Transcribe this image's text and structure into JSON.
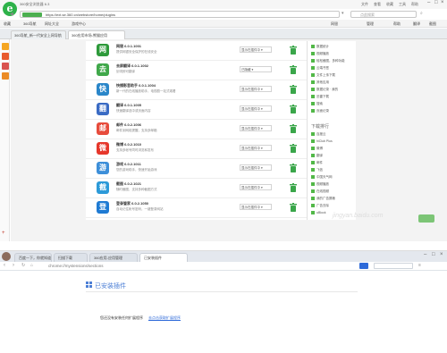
{
  "top_browser": {
    "title": "360安全浏览器 6.3",
    "menu": [
      "文件",
      "查看",
      "收藏",
      "工具",
      "帮助"
    ],
    "address": "https://ext.se.360.cn/webstore/home/plugins",
    "search_placeholder": "点此搜索",
    "bookmarks": [
      "收藏",
      "360导航",
      "网址大全",
      "游戏中心",
      "网银",
      "管理",
      "帮助",
      "翻译",
      "截图"
    ],
    "tabs": [
      "360导航_新一代安全上网导航",
      "360应用市场-熊猫应用"
    ],
    "extensions": [
      {
        "name": "网银",
        "version": "6.0.1.1001",
        "desc": "提供网银安全保护的在线安全",
        "status": "显示在插件中",
        "icon": "bank-icon",
        "color": "#2d9a3a"
      },
      {
        "name": "去屏翻译",
        "version": "6.0.1.1002",
        "desc": "划词即可翻译",
        "status": "已隐藏",
        "icon": "translate-icon",
        "color": "#40a84a"
      },
      {
        "name": "快播影音助手",
        "version": "6.0.1.1004",
        "desc": "新一代的在线播放助手，电视剧一站式观看",
        "status": "显示在插件中",
        "icon": "play-icon",
        "color": "#2a86c9"
      },
      {
        "name": "翻译",
        "version": "6.0.1.1005",
        "desc": "快速翻译选中或页面内容",
        "status": "显示在插件中",
        "icon": "translate-icon",
        "color": "#3a6bc4"
      },
      {
        "name": "邮件",
        "version": "6.0.2.1006",
        "desc": "邮件到网络提醒，支持多邮箱",
        "status": "显示在插件中",
        "icon": "mail-icon",
        "color": "#e74c3c"
      },
      {
        "name": "微博",
        "version": "6.0.2.1010",
        "desc": "支持多帐号同时浏览和发布",
        "status": "显示在插件中",
        "icon": "weibo-icon",
        "color": "#e6372b"
      },
      {
        "name": "游戏",
        "version": "6.0.2.1011",
        "desc": "您的游戏助手，快速开始游戏",
        "status": "显示在插件中",
        "icon": "game-icon",
        "color": "#3d8fd9"
      },
      {
        "name": "截图",
        "version": "6.0.2.1021",
        "desc": "随时截图，支持多种截图方式",
        "status": "显示在插件中",
        "icon": "screenshot-icon",
        "color": "#2c9ad8"
      },
      {
        "name": "登录管家",
        "version": "6.0.2.1050",
        "desc": "自动记住帐号密码，一键登录网站",
        "status": "显示在插件中",
        "icon": "wrench-icon",
        "color": "#1f7bd3"
      }
    ],
    "side_items_top": [
      "数据统计",
      "视频播放",
      "轻松截图，多种功能",
      "云端书签",
      "文件上传下载",
      "其他应用",
      "数据记录 · 我的",
      "迅雷下载",
      "搜索",
      "页面记录"
    ],
    "side_title": "下载排行",
    "side_items_bottom": [
      "百度云",
      "hiClub Plus",
      "微博",
      "翻译",
      "邮件",
      "飞信",
      "中国天气网",
      "视频播放",
      "在线视频",
      "我的广告屏蔽",
      "广告去除",
      "uBlock"
    ],
    "watermark": "jingyan.baidu.com"
  },
  "bottom_browser": {
    "tabs": [
      "百度一下，你就知道",
      "扫描下载",
      "360应用-应用管理",
      "已安装插件"
    ],
    "address": "chrome://mystensions/sections",
    "heading": "已安装插件",
    "empty_text": "您还没有安装任何扩展程序",
    "link_text": "去点击获取扩展程序"
  }
}
